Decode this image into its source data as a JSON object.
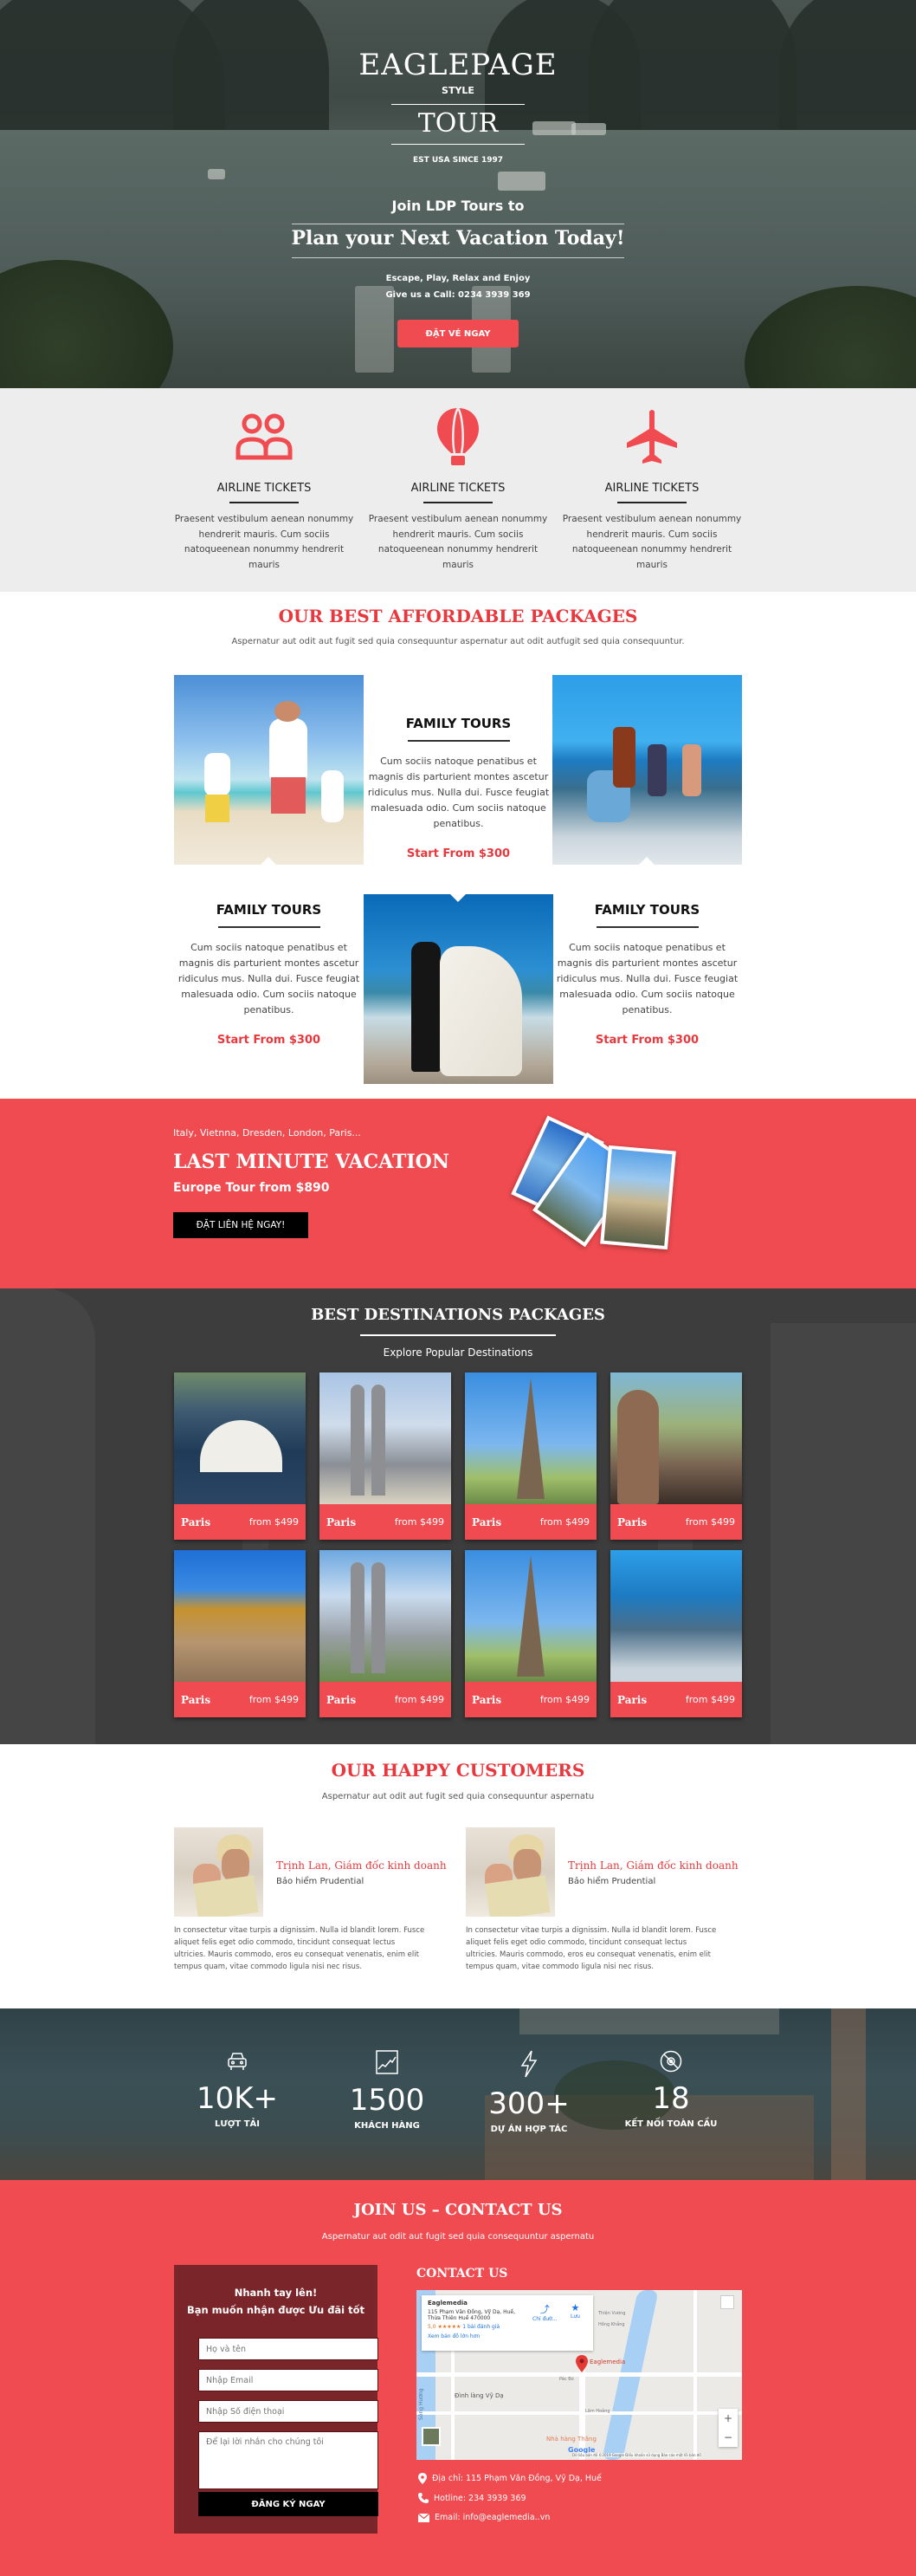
{
  "hero": {
    "brand": "EAGLEPAGE",
    "style": "STYLE",
    "tour": "TOUR",
    "est": "EST USA SINCE 1997",
    "join": "Join LDP Tours to",
    "plan": "Plan your Next Vacation Today!",
    "escape": "Escape, Play, Relax and Enjoy",
    "call": "Give us a Call: 0234 3939 369",
    "cta": "ĐẶT VÉ NGAY"
  },
  "services": [
    {
      "icon": "users-icon",
      "title": "AIRLINE TICKETS",
      "text": "Praesent vestibulum aenean nonummy hendrerit mauris. Cum sociis natoqueenean nonummy hendrerit mauris"
    },
    {
      "icon": "hot-air-balloon-icon",
      "title": "AIRLINE TICKETS",
      "text": "Praesent vestibulum aenean nonummy hendrerit mauris. Cum sociis natoqueenean nonummy hendrerit mauris"
    },
    {
      "icon": "airplane-icon",
      "title": "AIRLINE TICKETS",
      "text": "Praesent vestibulum aenean nonummy hendrerit mauris. Cum sociis natoqueenean nonummy hendrerit mauris"
    }
  ],
  "packages": {
    "title": "OUR BEST AFFORDABLE PACKAGES",
    "subtitle": "Aspernatur aut odit aut fugit sed quia consequuntur aspernatur aut odit autfugit sed quia consequuntur.",
    "items": [
      {
        "title": "FAMILY TOURS",
        "text": "Cum sociis natoque penatibus et magnis dis parturient montes ascetur ridiculus mus. Nulla dui. Fusce feugiat malesuada odio. Cum sociis natoque penatibus.",
        "price": "Start From $300"
      },
      {
        "title": "FAMILY TOURS",
        "text": "Cum sociis natoque penatibus et magnis dis parturient montes ascetur ridiculus mus. Nulla dui. Fusce feugiat malesuada odio. Cum sociis natoque penatibus.",
        "price": "Start From $300"
      },
      {
        "title": "FAMILY TOURS",
        "text": "Cum sociis natoque penatibus et magnis dis parturient montes ascetur ridiculus mus. Nulla dui. Fusce feugiat malesuada odio. Cum sociis natoque penatibus.",
        "price": "Start From $300"
      }
    ]
  },
  "lastminute": {
    "cities": "Italy, Vietnna, Dresden, London, Paris...",
    "title": "LAST MINUTE VACATION",
    "subtitle": "Europe Tour from $890",
    "cta": "ĐẶT LIÊN HỆ NGAY!"
  },
  "destinations": {
    "title": "BEST DESTINATIONS PACKAGES",
    "subtitle": "Explore Popular Destinations",
    "cards": [
      {
        "city": "Paris",
        "price": "from $499",
        "scene": "opera-house"
      },
      {
        "city": "Paris",
        "price": "from $499",
        "scene": "towers-mosque"
      },
      {
        "city": "Paris",
        "price": "from $499",
        "scene": "eiffel"
      },
      {
        "city": "Paris",
        "price": "from $499",
        "scene": "buddha"
      },
      {
        "city": "Paris",
        "price": "from $499",
        "scene": "arena"
      },
      {
        "city": "Paris",
        "price": "from $499",
        "scene": "twin-towers"
      },
      {
        "city": "Paris",
        "price": "from $499",
        "scene": "eiffel"
      },
      {
        "city": "Paris",
        "price": "from $499",
        "scene": "boat"
      }
    ]
  },
  "customers": {
    "title": "OUR HAPPY CUSTOMERS",
    "subtitle": "Aspernatur aut odit aut fugit sed quia consequuntur aspernatu",
    "items": [
      {
        "name": "Trịnh Lan, Giám đốc kinh doanh",
        "company": "Bảo hiểm Prudential",
        "quote": "In consectetur vitae turpis a dignissim. Nulla id blandit lorem. Fusce aliquet felis eget odio commodo, tincidunt consequat lectus ultricies. Mauris commodo, eros eu consequat venenatis, enim elit tempus quam, vitae commodo ligula nisi nec risus."
      },
      {
        "name": "Trịnh Lan, Giám đốc kinh doanh",
        "company": "Bảo hiểm Prudential",
        "quote": "In consectetur vitae turpis a dignissim. Nulla id blandit lorem. Fusce aliquet felis eget odio commodo, tincidunt consequat lectus ultricies. Mauris commodo, eros eu consequat venenatis, enim elit tempus quam, vitae commodo ligula nisi nec risus."
      }
    ]
  },
  "stats": [
    {
      "icon": "car-icon",
      "value": "10K+",
      "label": "LƯỢT TẢI"
    },
    {
      "icon": "chart-icon",
      "value": "1500",
      "label": "KHÁCH HÀNG"
    },
    {
      "icon": "lightning-icon",
      "value": "300+",
      "label": "DỰ ÁN HỢP TÁC"
    },
    {
      "icon": "disc-icon",
      "value": "18",
      "label": "KẾT NỐI TOÀN CẦU"
    }
  ],
  "contact": {
    "title": "JOIN US – CONTACT US",
    "subtitle": "Aspernatur aut odit aut fugit sed quia consequuntur aspernatu",
    "form": {
      "heading1": "Nhanh tay lên!",
      "heading2": "Bạn muốn nhận được Ưu đãi tốt",
      "name_placeholder": "Họ và tên",
      "email_placeholder": "Nhập Email",
      "phone_placeholder": "Nhập Số điện thoại",
      "message_placeholder": "Để lại lời nhắn cho chúng tôi",
      "submit": "ĐĂNG KÝ NGAY"
    },
    "heading": "CONTACT US",
    "map": {
      "place": "Eaglemedia",
      "address1": "115 Phạm Văn Đồng, Vỹ Dạ, Huế,",
      "address2": "Thừa Thiên Huế 470000",
      "rating": "5,0 ★★★★★",
      "reviews": "1 bài đánh giá",
      "larger_map": "Xem bản đồ lớn hơn",
      "directions": "Chỉ đườ...",
      "save": "Lưu",
      "pin_label": "Eaglemedia",
      "labels": [
        "Đình làng Vỹ Dạ",
        "Nhà hàng Thắng",
        "Sông Hương",
        "Lâm Hoằng",
        "Pác Bó",
        "Thiện Vương",
        "Hồng Khẳng"
      ],
      "zoom_in": "+",
      "zoom_out": "−",
      "google": "Google",
      "footer": "Dữ liệu bản đồ ©2019 Google   Điều khoản sử dụng   Báo cáo một lỗi bản đồ"
    },
    "address": "Địa chỉ: 115 Phạm Văn Đồng, Vỹ Dạ, Huế",
    "hotline": "Hotline: 234 3939 369",
    "email": "Email: info@eaglemedia..vn"
  },
  "colors": {
    "accent": "#ef4b50",
    "accent_text": "#e8383e",
    "dark": "#3d3d3d",
    "form_bg": "#7a2529"
  }
}
